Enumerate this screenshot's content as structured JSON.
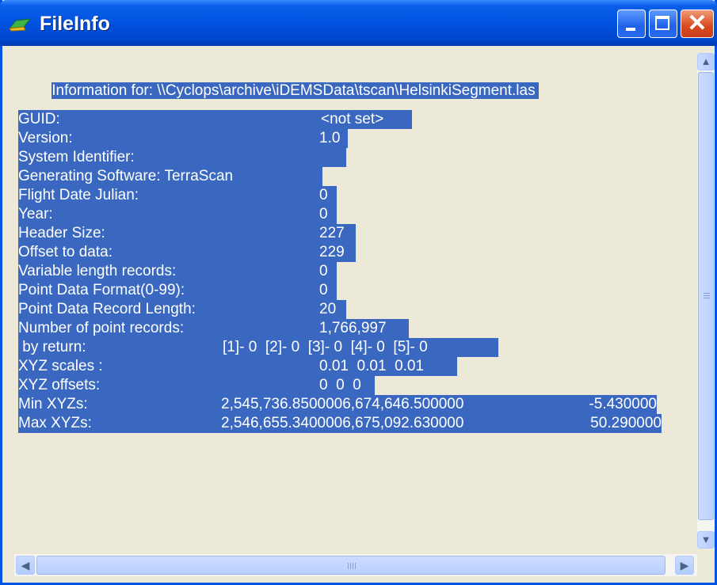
{
  "window": {
    "title": "FileInfo"
  },
  "info_header": "Information for: \\\\Cyclops\\archive\\iDEMSData\\tscan\\HelsinkiSegment.las",
  "rows": [
    {
      "label": "GUID:",
      "value": "<not set>"
    },
    {
      "label": "Version:",
      "value": "1.0"
    },
    {
      "label": "System Identifier:",
      "value": ""
    },
    {
      "label": "Generating Software: TerraScan",
      "value": ""
    },
    {
      "label": "Flight Date Julian:",
      "value": "0"
    },
    {
      "label": "Year:",
      "value": "0"
    },
    {
      "label": "Header Size:",
      "value": "227"
    },
    {
      "label": "Offset to data:",
      "value": "229"
    },
    {
      "label": "Variable length records:",
      "value": "0"
    },
    {
      "label": "Point Data Format(0-99):",
      "value": "0"
    },
    {
      "label": "Point Data Record Length:",
      "value": "20"
    },
    {
      "label": "Number of point records:",
      "value": "1,766,997"
    },
    {
      "label": " by return:",
      "value": "[1]- 0  [2]- 0  [3]- 0  [4]- 0  [5]- 0"
    },
    {
      "label": "XYZ scales :",
      "value": "0.01  0.01  0.01"
    },
    {
      "label": "XYZ offsets:",
      "value": "0  0  0"
    },
    {
      "label": "Min XYZs:",
      "value": "2,545,736.8500006,674,646.500000",
      "extra": "-5.430000"
    },
    {
      "label": "Max XYZs:",
      "value": "2,546,655.3400006,675,092.630000",
      "extra": "50.290000"
    }
  ]
}
